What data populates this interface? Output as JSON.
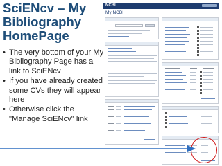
{
  "slide": {
    "title": "SciENcv – My Bibliography HomePage",
    "bullets": [
      "The very bottom of your My Bibliography Page has a link to SciENcv",
      "If you have already created some CVs they will appear here",
      "Otherwise click the \"Manage SciENcv\" link"
    ]
  },
  "screenshot": {
    "site_logo": "NCBI",
    "page_title": "My NCBI"
  },
  "colors": {
    "title": "#1f4e79",
    "ncbi_bar": "#1e3c6f",
    "highlight": "#d01818",
    "arrow": "#2f6fc0"
  }
}
